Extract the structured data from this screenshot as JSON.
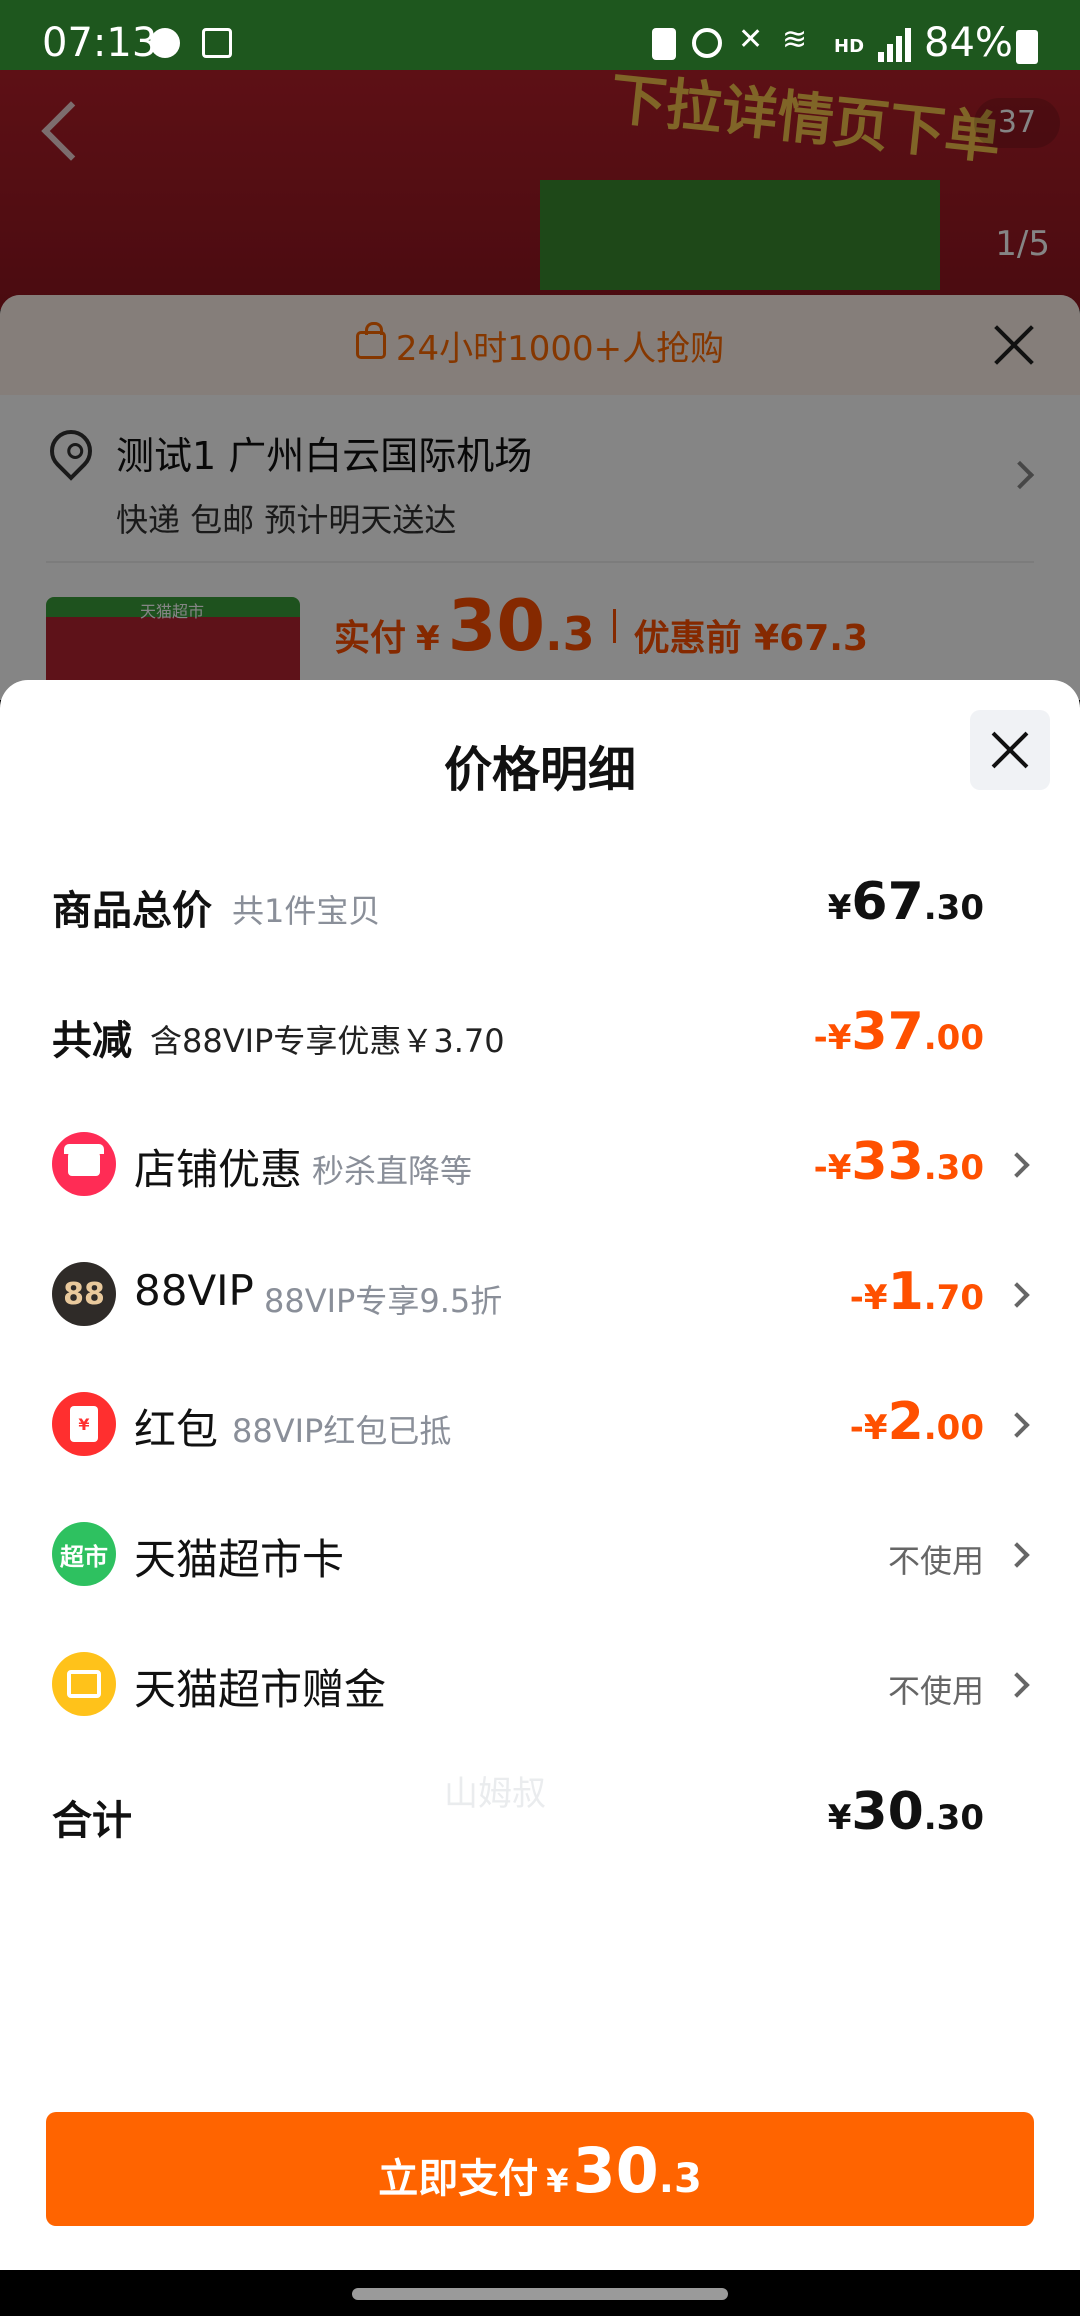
{
  "status_bar": {
    "time": "07:13",
    "network_label": "HD",
    "network_type": "4G",
    "battery_percent": "84%"
  },
  "background": {
    "banner_promo": "下拉详情页下单",
    "banner_counter": "37",
    "page_indicator": "1/5",
    "hot_text": "24小时1000+人抢购",
    "address": "测试1 广州白云国际机场",
    "shipping": "快递 包邮 预计明天送达",
    "thumb_label": "天猫超市",
    "pay_label": "实付",
    "pay_currency": "¥",
    "pay_int": "30",
    "pay_dec": ".3",
    "before_discount": "优惠前 ¥67.3"
  },
  "sheet": {
    "title": "价格明细",
    "watermark": "山姆叔",
    "rows": {
      "subtotal": {
        "label": "商品总价",
        "sub": "共1件宝贝",
        "cur": "¥",
        "int": "67",
        "dec": ".30"
      },
      "discount": {
        "label": "共减",
        "sub": "含88VIP专享优惠￥3.70",
        "cur": "-¥",
        "int": "37",
        "dec": ".00"
      },
      "store": {
        "label": "店铺优惠",
        "sub": "秒杀直降等",
        "cur": "-¥",
        "int": "33",
        "dec": ".30",
        "icon": "store-icon"
      },
      "vip": {
        "label": "88VIP",
        "sub": "88VIP专享9.5折",
        "cur": "-¥",
        "int": "1",
        "dec": ".70",
        "icon_text": "88"
      },
      "hongbao": {
        "label": "红包",
        "sub": "88VIP红包已抵",
        "cur": "-¥",
        "int": "2",
        "dec": ".00",
        "icon_text": "¥"
      },
      "card": {
        "label": "天猫超市卡",
        "status": "不使用",
        "icon_text": "超市"
      },
      "gift": {
        "label": "天猫超市赠金",
        "status": "不使用",
        "icon": "gift-card-icon"
      },
      "total": {
        "label": "合计",
        "cur": "¥",
        "int": "30",
        "dec": ".30"
      }
    },
    "pay_button": {
      "label": "立即支付",
      "cur": "¥",
      "int": "30",
      "dec": ".3"
    }
  },
  "colors": {
    "accent": "#ff5000",
    "pay_button": "#ff6400",
    "text": "#111111",
    "muted": "#8a8f99"
  }
}
